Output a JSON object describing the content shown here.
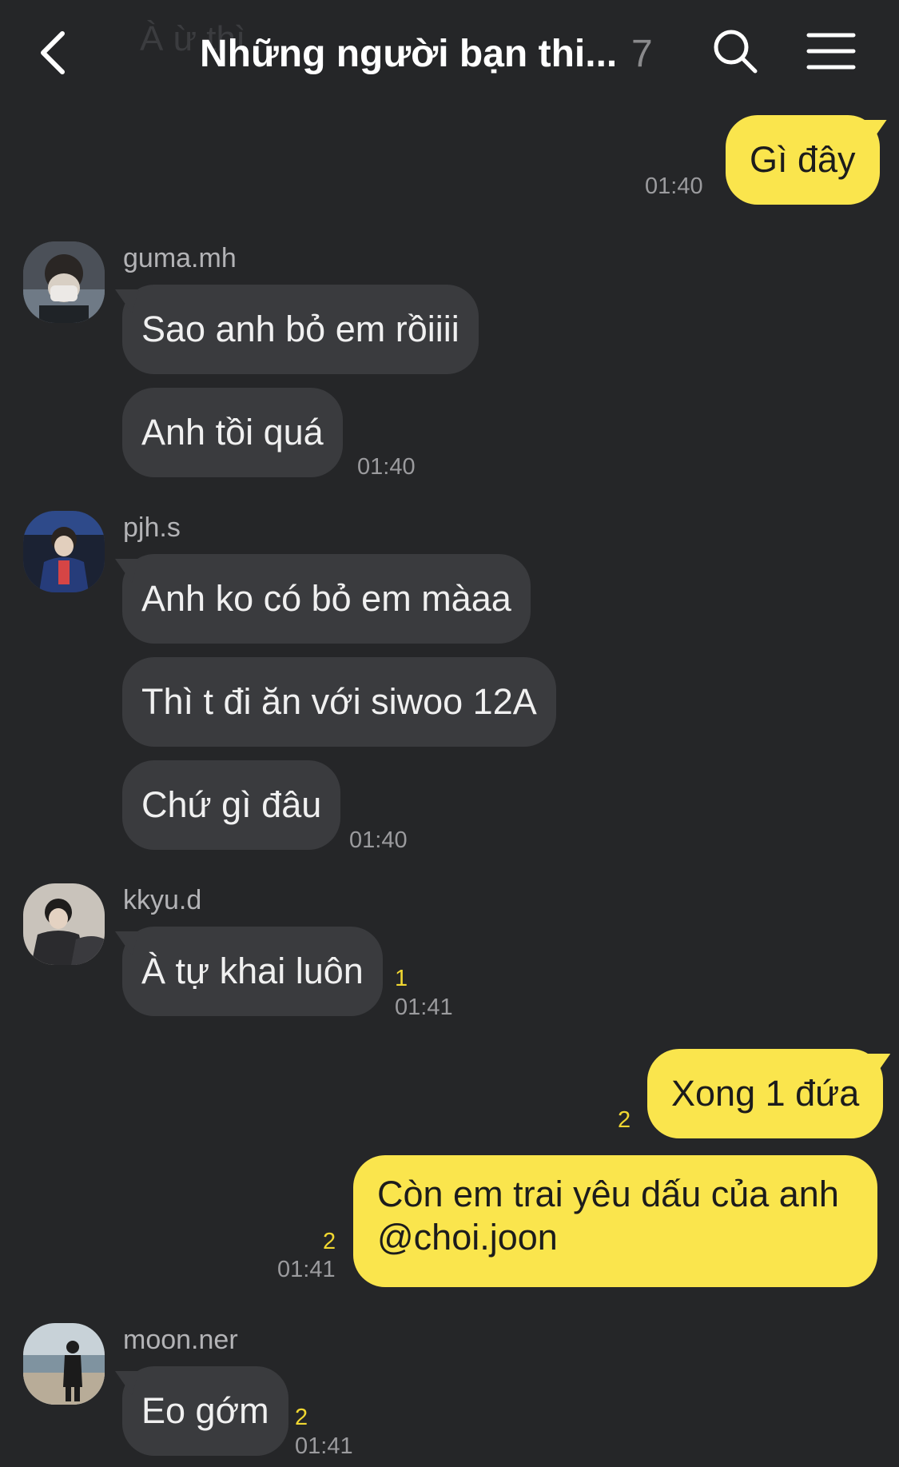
{
  "header": {
    "ghost_text": "À ừ thì",
    "title": "Những người bạn thi...",
    "member_count": "7",
    "back_icon": "chevron-left-icon",
    "search_icon": "search-icon",
    "menu_icon": "hamburger-menu-icon"
  },
  "messages": [
    {
      "text": "Gì đây",
      "time": "01:40"
    },
    {
      "sender": "guma.mh",
      "texts": [
        "Sao anh bỏ em rồiiii",
        "Anh tồi quá"
      ],
      "time": "01:40"
    },
    {
      "sender": "pjh.s",
      "texts": [
        "Anh ko có bỏ em màaa",
        "Thì t đi ăn với siwoo 12A",
        "Chứ gì đâu"
      ],
      "time": "01:40"
    },
    {
      "sender": "kkyu.d",
      "text": "À tự khai luôn",
      "unread": "1",
      "time": "01:41"
    },
    {
      "text": "Xong 1 đứa",
      "unread": "2"
    },
    {
      "lines": [
        "Còn em trai yêu dấu của anh",
        "@choi.joon"
      ],
      "unread": "2",
      "time": "01:41"
    },
    {
      "sender": "moon.ner",
      "text": "Eo gớm",
      "unread": "2",
      "time": "01:41"
    }
  ],
  "colors": {
    "background": "#252628",
    "outgoing_bubble": "#fae54d",
    "incoming_bubble": "#3a3b3e",
    "unread_count": "#f1d731"
  }
}
